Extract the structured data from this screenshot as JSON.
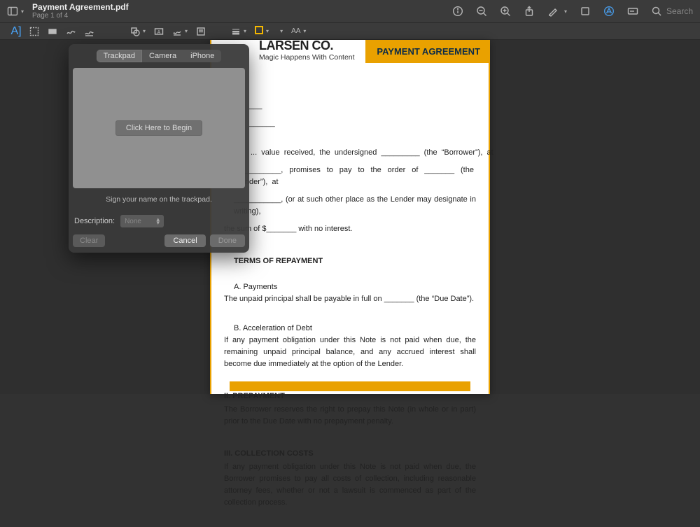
{
  "toolbar": {
    "title": "Payment Agreement.pdf",
    "subtitle": "Page 1 of 4",
    "search_placeholder": "Search",
    "aa": "AA"
  },
  "popup": {
    "tabs": [
      "Trackpad",
      "Camera",
      "iPhone"
    ],
    "active_tab": 0,
    "begin": "Click Here to Begin",
    "instruction": "Sign your name on the trackpad.",
    "desc_label": "Description:",
    "desc_value": "None",
    "clear": "Clear",
    "cancel": "Cancel",
    "done": "Done"
  },
  "doc": {
    "company": "LARSEN CO.",
    "tagline": "Magic Happens With Content",
    "badge": "PAYMENT AGREEMENT",
    "line_blank_top": "_______________",
    "p1a": "...  value  received,  the  undersigned  _________  (the  “Borrower”),  at",
    "p1b": "___________,  promises  to  pay  to  the  order  of  _______  (the  “Lender”),  at",
    "p1c": "___________, (or at such other place as the Lender may designate in writing),",
    "p1d": "the sum of $_______ with no interest.",
    "h1": "TERMS OF REPAYMENT",
    "a_hdr": "A. Payments",
    "a_txt": "The unpaid principal shall be payable in full on _______ (the “Due Date”).",
    "b_hdr": "B. Acceleration of Debt",
    "b_txt": "If any payment obligation under this Note is not paid when due, the remaining unpaid principal balance, and any accrued interest shall become due immediately at the option of the Lender.",
    "h2": "II. PREPAYMENT",
    "h2_txt": "The Borrower reserves the right to prepay this Note (in whole or in part) prior to the Due Date with no prepayment penalty.",
    "h3": "III. COLLECTION COSTS",
    "h3_txt": "If any payment obligation under this Note is not paid when due, the Borrower promises to pay all costs of collection, including reasonable attorney fees, whether or not a lawsuit is commenced as part of the collection process."
  }
}
